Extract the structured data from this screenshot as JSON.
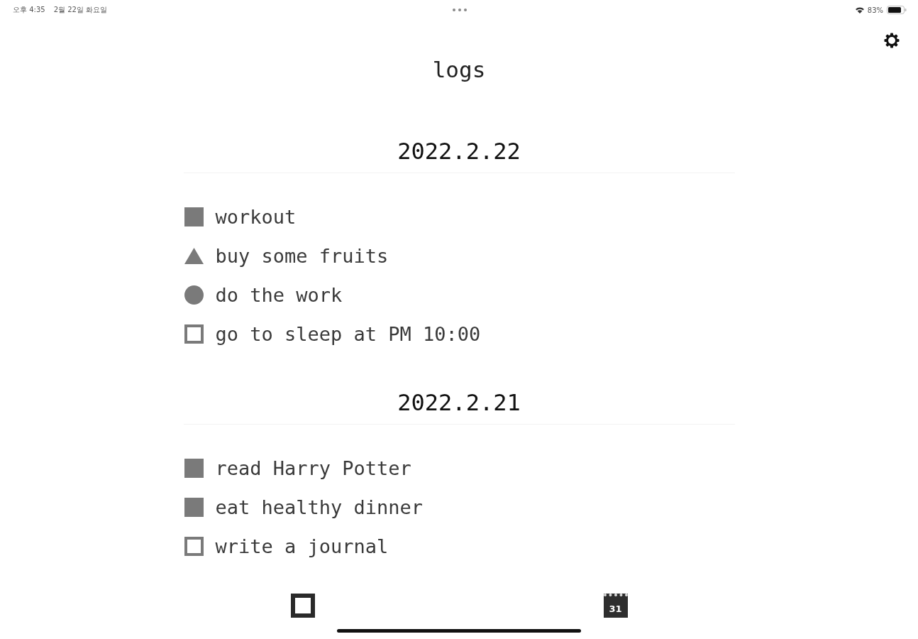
{
  "status_bar": {
    "time": "오후 4:35",
    "date": "2월 22일 화요일",
    "battery": "83%"
  },
  "title": "logs",
  "days": [
    {
      "date": "2022.2.22",
      "entries": [
        {
          "text": "workout",
          "kind": "square"
        },
        {
          "text": "buy some fruits",
          "kind": "triangle"
        },
        {
          "text": "do the work",
          "kind": "circle"
        },
        {
          "text": "go to sleep at PM 10:00",
          "kind": "box"
        }
      ]
    },
    {
      "date": "2022.2.21",
      "entries": [
        {
          "text": "read Harry Potter",
          "kind": "square"
        },
        {
          "text": "eat healthy dinner",
          "kind": "square"
        },
        {
          "text": "write a journal",
          "kind": "box"
        }
      ]
    }
  ],
  "tab_bar": {
    "items": [
      {
        "kind": "square"
      },
      {
        "kind": "calendar",
        "label": "31"
      }
    ]
  }
}
